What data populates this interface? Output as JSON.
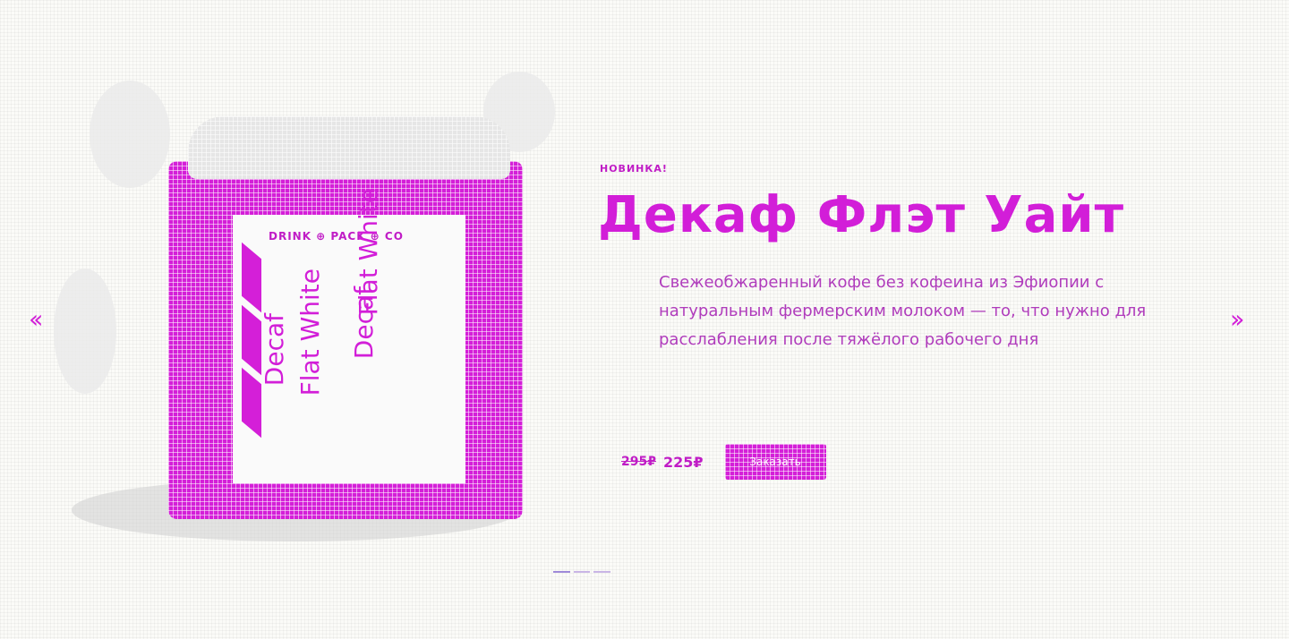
{
  "colors": {
    "accent": "#d21ed8",
    "background": "#fbfbf8",
    "button_text": "#ffffff"
  },
  "nav": {
    "prev_label": "‹‹",
    "next_label": "››"
  },
  "product": {
    "eyebrow": "НОВИНКА!",
    "title": "Декаф Флэт Уайт",
    "description": "Свежеобжаренный кофе без кофеина из Эфиопии с натуральным фермерским молоком — то, что нужно для расслабления после тяжёлого рабочего дня",
    "old_price": "295₽",
    "new_price": "225₽",
    "order_label": "Заказать",
    "can": {
      "brand": "DRINK ⊕ PACK ⊕ CO",
      "line1": "Decaf",
      "line2": "Flat White"
    }
  },
  "pagination": {
    "count": 3,
    "active": 0
  }
}
